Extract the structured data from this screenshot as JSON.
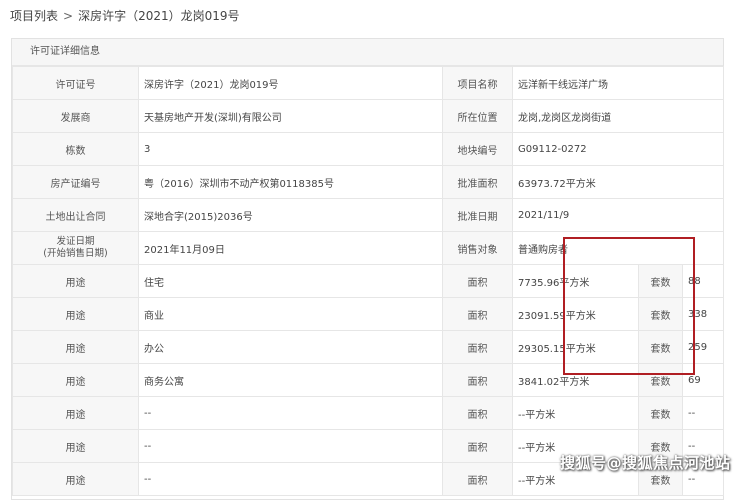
{
  "breadcrumb": {
    "root": "项目列表",
    "sep": ">",
    "current": "深房许字（2021）龙岗019号"
  },
  "panel": {
    "title": "许可证详细信息"
  },
  "info": {
    "license_no": {
      "label": "许可证号",
      "value": "深房许字（2021）龙岗019号"
    },
    "project_name": {
      "label": "项目名称",
      "value": "远洋新干线远洋广场"
    },
    "developer": {
      "label": "发展商",
      "value": "天基房地产开发(深圳)有限公司"
    },
    "location": {
      "label": "所在位置",
      "value": "龙岗,龙岗区龙岗街道"
    },
    "buildings": {
      "label": "栋数",
      "value": "3"
    },
    "plot_no": {
      "label": "地块编号",
      "value": "G09112-0272"
    },
    "property_cert": {
      "label": "房产证编号",
      "value": "粤（2016）深圳市不动产权第0118385号"
    },
    "approved_area": {
      "label": "批准面积",
      "value": "63973.72平方米"
    },
    "land_contract": {
      "label": "土地出让合同",
      "value": "深地合字(2015)2036号"
    },
    "approval_date": {
      "label": "批准日期",
      "value": "2021/11/9"
    },
    "issue_date": {
      "label_line1": "发证日期",
      "label_line2": "(开始销售日期)",
      "value": "2021年11月09日"
    },
    "sales_target": {
      "label": "销售对象",
      "value": "普通购房者"
    }
  },
  "usage_rows": [
    {
      "use_label": "用途",
      "use": "住宅",
      "area_label": "面积",
      "area": "7735.96平方米",
      "units_label": "套数",
      "units": "88"
    },
    {
      "use_label": "用途",
      "use": "商业",
      "area_label": "面积",
      "area": "23091.59平方米",
      "units_label": "套数",
      "units": "338"
    },
    {
      "use_label": "用途",
      "use": "办公",
      "area_label": "面积",
      "area": "29305.15平方米",
      "units_label": "套数",
      "units": "259"
    },
    {
      "use_label": "用途",
      "use": "商务公寓",
      "area_label": "面积",
      "area": "3841.02平方米",
      "units_label": "套数",
      "units": "69"
    },
    {
      "use_label": "用途",
      "use": "--",
      "area_label": "面积",
      "area": "--平方米",
      "units_label": "套数",
      "units": "--"
    },
    {
      "use_label": "用途",
      "use": "--",
      "area_label": "面积",
      "area": "--平方米",
      "units_label": "套数",
      "units": "--"
    },
    {
      "use_label": "用途",
      "use": "--",
      "area_label": "面积",
      "area": "--平方米",
      "units_label": "套数",
      "units": "--"
    }
  ],
  "watermark": "搜狐号@搜狐焦点河池站",
  "colors": {
    "highlight": "#b01e23",
    "label_bg": "#f7f7f7",
    "border": "#e6e6e6"
  }
}
